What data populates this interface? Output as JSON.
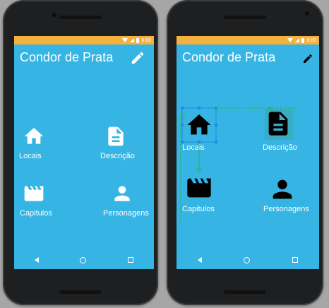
{
  "app": {
    "title": "Condor de Prata",
    "status_time": "6:00"
  },
  "grid": {
    "locais": "Locais",
    "descricao": "Descrição",
    "capitulos": "Capitulos",
    "personagens": "Personagens"
  },
  "icons": {
    "edit": "edit-pencil-icon",
    "locais": "home-icon",
    "descricao": "document-icon",
    "capitulos": "clapperboard-icon",
    "personagens": "person-icon"
  },
  "colors": {
    "screen": "#36b5e4",
    "statusbar": "#f5b13d",
    "selection": "#1e88e5",
    "guide": "#2db34a"
  }
}
